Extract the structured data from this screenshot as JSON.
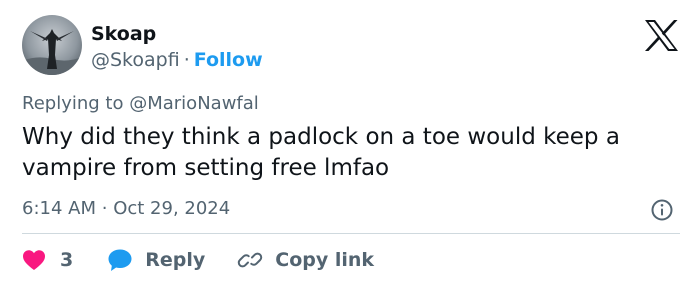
{
  "author": {
    "name": "Skoap",
    "handle": "@Skoapfi",
    "separator": "·",
    "follow_label": "Follow"
  },
  "reply_context": {
    "prefix": "Replying to",
    "mention": "@MarioNawfal"
  },
  "tweet": {
    "text": "Why did they think a padlock on a toe would keep a vampire from setting free lmfao",
    "time": "6:14 AM",
    "separator": "·",
    "date": "Oct 29, 2024"
  },
  "actions": {
    "like_count": "3",
    "reply_label": "Reply",
    "copy_link_label": "Copy link"
  },
  "icons": {
    "logo": "x-logo-icon",
    "info": "info-icon",
    "like": "heart-icon",
    "reply": "speech-bubble-icon",
    "copy": "link-icon"
  },
  "colors": {
    "text": "#0f1419",
    "secondary": "#536471",
    "accent": "#1d9bf0",
    "like": "#f91880",
    "divider": "#cfd9de"
  }
}
